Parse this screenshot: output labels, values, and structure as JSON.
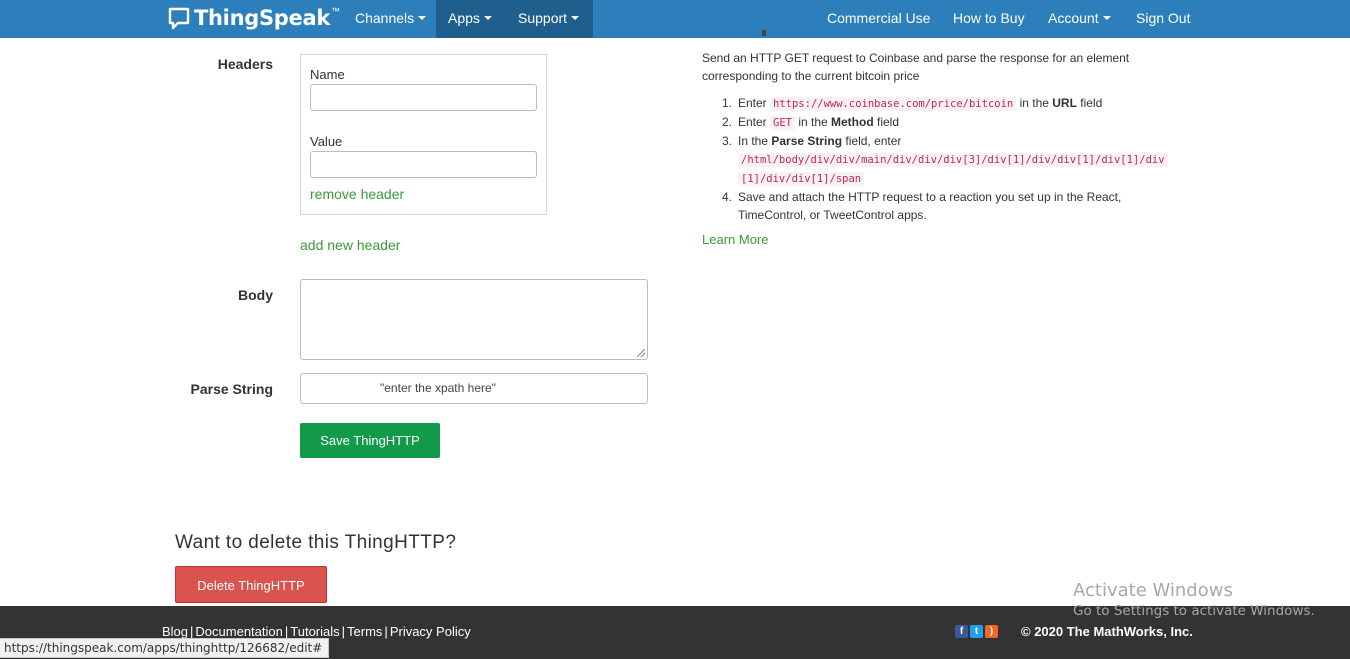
{
  "navbar": {
    "brand": "ThingSpeak",
    "brand_tm": "™",
    "left_items": [
      "Channels",
      "Apps",
      "Support"
    ],
    "right_items": [
      "Commercial Use",
      "How to Buy",
      "Account",
      "Sign Out"
    ]
  },
  "form": {
    "headers_label": "Headers",
    "header_name_label": "Name",
    "header_name_value": "",
    "header_value_label": "Value",
    "header_value_value": "",
    "remove_header": "remove header",
    "add_header": "add new header",
    "body_label": "Body",
    "body_value": "",
    "parse_label": "Parse String",
    "parse_value": "\"enter the xpath here\"",
    "save_button": "Save ThingHTTP"
  },
  "delete": {
    "heading": "Want to delete this ThingHTTP?",
    "button": "Delete ThingHTTP"
  },
  "help": {
    "intro": "Send an HTTP GET request to Coinbase and parse the response for an element corresponding to the current bitcoin price",
    "step1_pre": "Enter ",
    "step1_code": "https://www.coinbase.com/price/bitcoin",
    "step1_mid": " in the ",
    "step1_bold": "URL",
    "step1_post": " field",
    "step2_pre": "Enter ",
    "step2_code": "GET",
    "step2_mid": " in the ",
    "step2_bold": "Method",
    "step2_post": " field",
    "step3_pre": "In the ",
    "step3_bold": "Parse String",
    "step3_post": " field, enter",
    "step3_code_line1": "/html/body/div/div/main/div/div/div[3]/div[1]/div/div[1]/div[1]/div",
    "step3_code_line2": "[1]/div/div[1]/span",
    "step4": "Save and attach the HTTP request to a reaction you set up in the React, TimeControl, or TweetControl apps.",
    "learn_more": "Learn More"
  },
  "footer": {
    "links": [
      "Blog",
      "Documentation",
      "Tutorials",
      "Terms",
      "Privacy Policy"
    ],
    "copyright": "© 2020 The MathWorks, Inc.",
    "social_icons": [
      "facebook-icon",
      "twitter-icon",
      "rss-icon"
    ]
  },
  "overlay": {
    "activate_title": "Activate Windows",
    "activate_sub": "Go to Settings to activate Windows.",
    "status_url": "https://thingspeak.com/apps/thinghttp/126682/edit#"
  },
  "colors": {
    "navbar": "#2d7fbb",
    "navbar_active": "#1f5f8d",
    "save": "#13994a",
    "delete": "#d9534f",
    "link": "#3a9a3a",
    "footer": "#333333"
  }
}
